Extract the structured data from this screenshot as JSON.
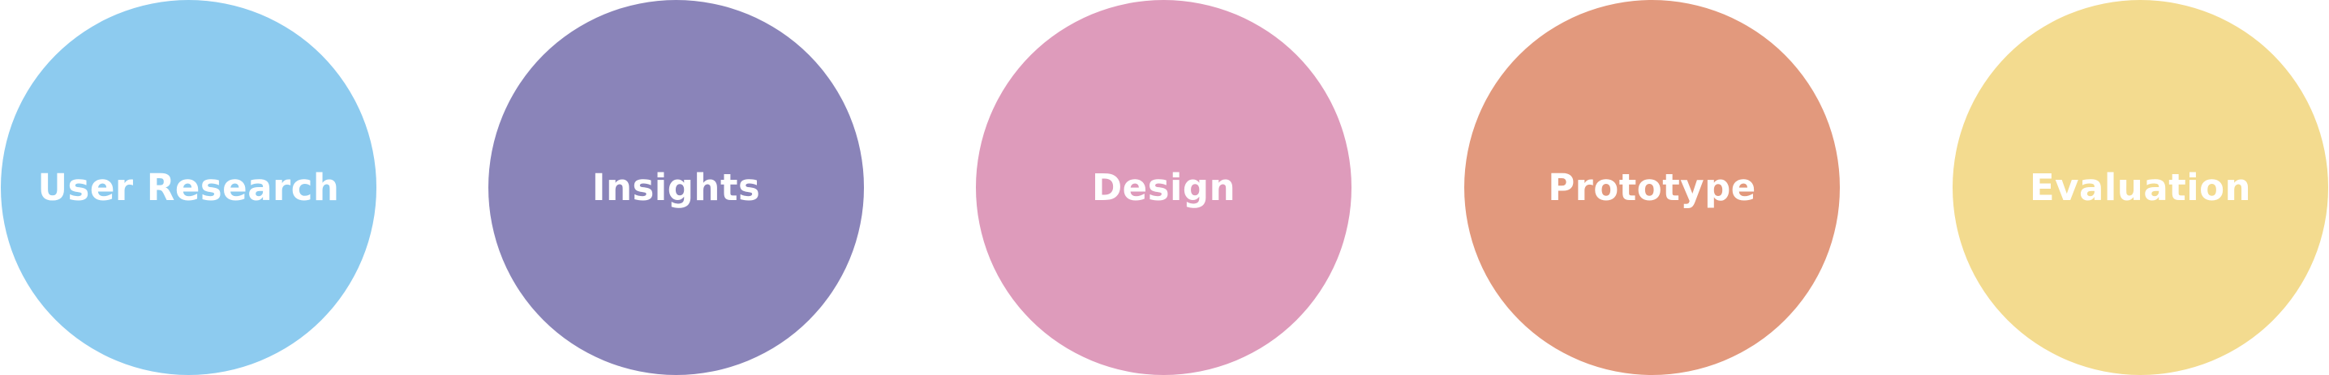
{
  "steps": [
    {
      "label": "User Research",
      "color": "#8dcbef"
    },
    {
      "label": "Insights",
      "color": "#8a84b9"
    },
    {
      "label": "Design",
      "color": "#de9bbb"
    },
    {
      "label": "Prototype",
      "color": "#e2997d"
    },
    {
      "label": "Evaluation",
      "color": "#f3db8f"
    }
  ]
}
